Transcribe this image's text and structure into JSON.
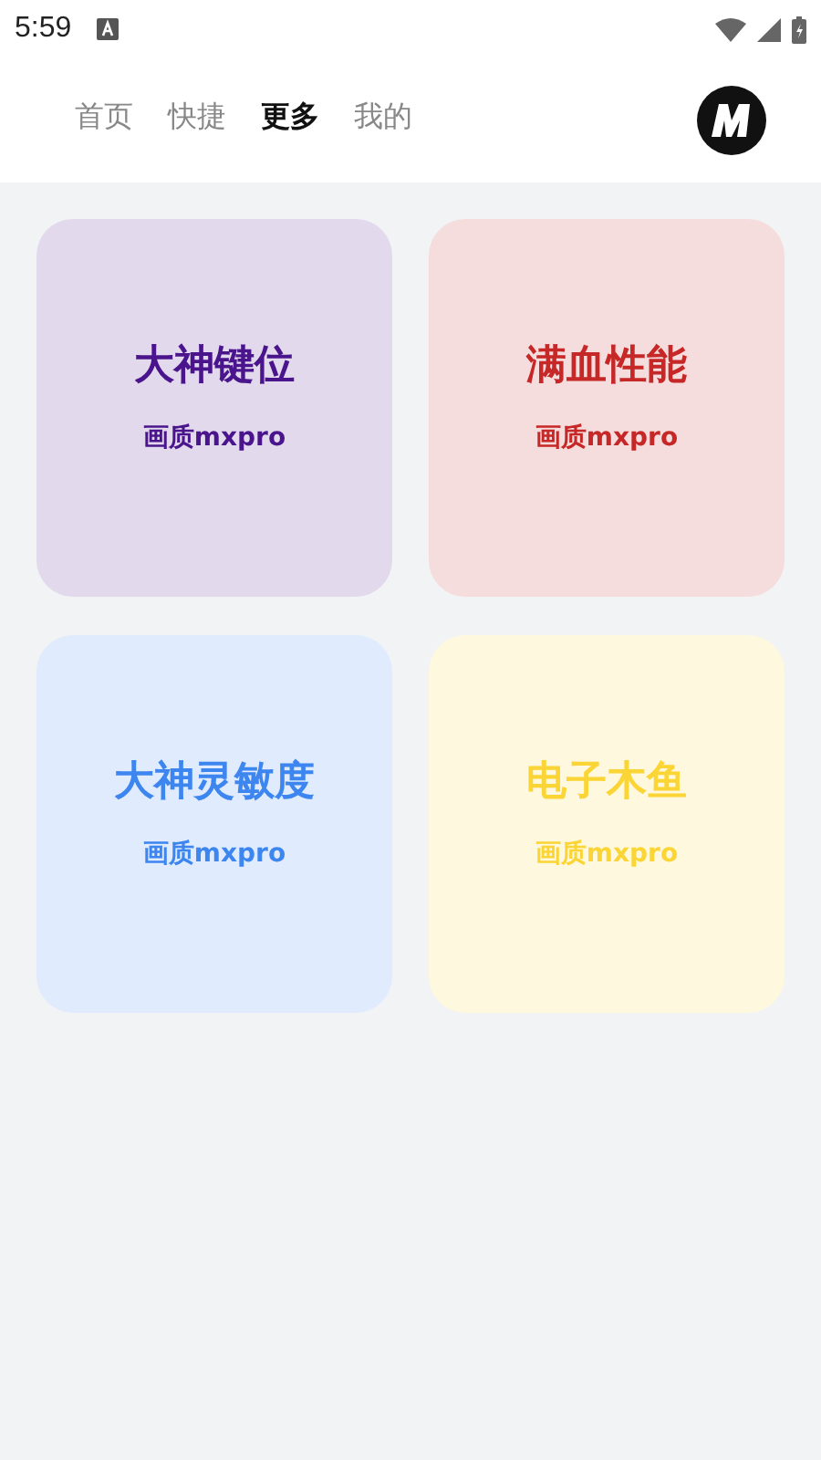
{
  "status_bar": {
    "time": "5:59"
  },
  "nav": {
    "tabs": [
      {
        "label": "首页",
        "selected": false
      },
      {
        "label": "快捷",
        "selected": false
      },
      {
        "label": "更多",
        "selected": true
      },
      {
        "label": "我的",
        "selected": false
      }
    ]
  },
  "cards": [
    {
      "title": "大神键位",
      "subtitle": "画质mxpro",
      "color": "#4a148c"
    },
    {
      "title": "满血性能",
      "subtitle": "画质mxpro",
      "color": "#c62828"
    },
    {
      "title": "大神灵敏度",
      "subtitle": "画质mxpro",
      "color": "#3d86f0"
    },
    {
      "title": "电子木鱼",
      "subtitle": "画质mxpro",
      "color": "#fbd535"
    }
  ]
}
